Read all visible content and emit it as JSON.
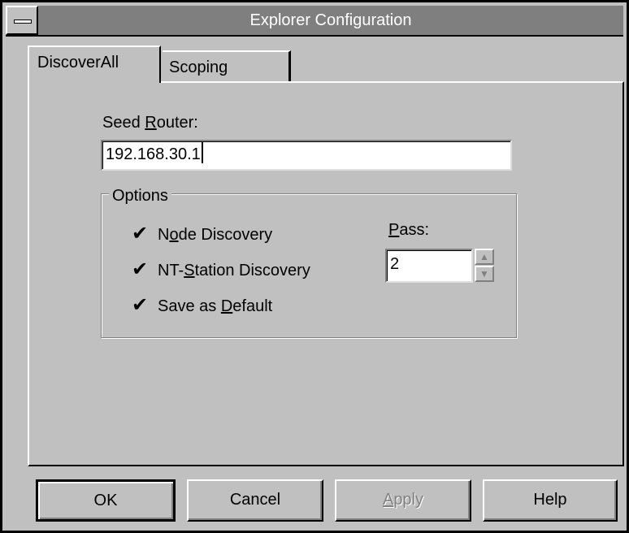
{
  "window": {
    "title": "Explorer Configuration"
  },
  "tabs": [
    {
      "label": "DiscoverAll",
      "active": true
    },
    {
      "label": "Scoping",
      "active": false
    }
  ],
  "seed_router": {
    "label_pre": "Seed ",
    "label_accel": "R",
    "label_post": "outer:",
    "value": "192.168.30.1"
  },
  "options": {
    "group_label": "Options",
    "items": [
      {
        "pre": "N",
        "accel": "o",
        "post": "de Discovery",
        "checked": true
      },
      {
        "pre": "NT-",
        "accel": "S",
        "post": "tation Discovery",
        "checked": true
      },
      {
        "pre": "Save as ",
        "accel": "D",
        "post": "efault",
        "checked": true
      }
    ],
    "pass": {
      "label_accel": "P",
      "label_post": "ass:",
      "value": "2"
    }
  },
  "buttons": {
    "ok": "OK",
    "cancel": "Cancel",
    "apply_accel": "A",
    "apply_post": "pply",
    "help": "Help"
  },
  "icons": {
    "system_menu": "minus-bar-icon",
    "check": "checkmark-icon",
    "spin_up": "up-arrow-icon",
    "spin_down": "down-arrow-icon"
  }
}
